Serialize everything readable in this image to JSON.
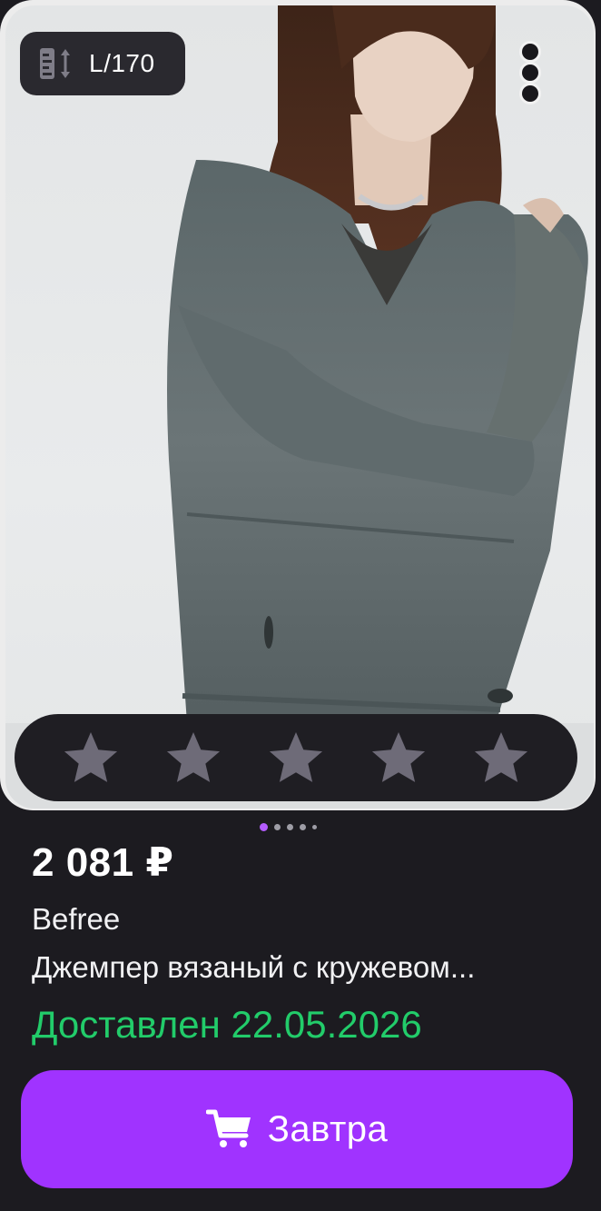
{
  "product": {
    "size_badge": "L/170",
    "size_icon": "height-ruler-icon",
    "more_icon": "more-vertical-icon",
    "rating": {
      "max": 5,
      "value": 0,
      "star_color": "#6e6b78"
    },
    "gallery": {
      "total": 5,
      "current": 1
    },
    "price": "2 081 ₽",
    "brand": "Befree",
    "name": "Джемпер вязаный с кружевом...",
    "delivery": "Доставлен 22.05.2026",
    "delivery_color": "#22cc6a"
  },
  "cart_button": {
    "label": "Завтра",
    "icon": "cart-icon",
    "color": "#a033ff"
  }
}
